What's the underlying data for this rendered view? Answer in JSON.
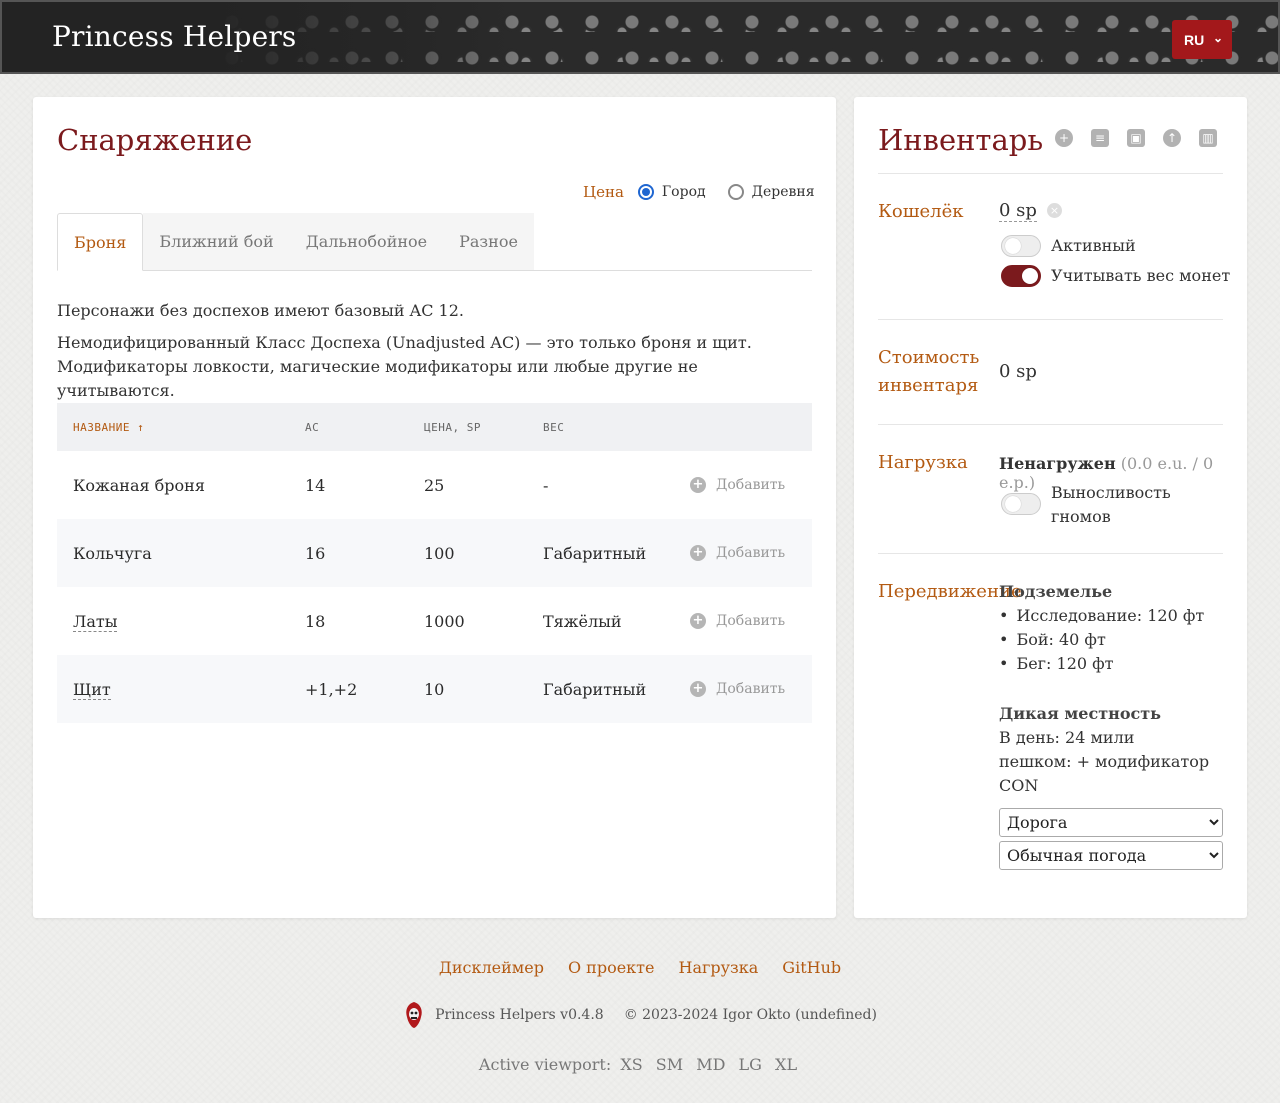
{
  "header": {
    "brand": "Princess Helpers",
    "lang": "RU"
  },
  "equipment": {
    "title": "Снаряжение",
    "price": {
      "label": "Цена",
      "options": [
        "Город",
        "Деревня"
      ],
      "selected": "Город"
    },
    "tabs": [
      "Броня",
      "Ближний бой",
      "Дальнобойное",
      "Разное"
    ],
    "active_tab": "Броня",
    "desc1": "Персонажи без доспехов имеют базовый AC 12.",
    "desc2": "Немодифицированный Класс Доспеха (Unadjusted AC) — это только броня и щит. Модификаторы ловкости, магические модификаторы или любые другие не учитываются.",
    "columns": {
      "name": "НАЗВАНИЕ ↑",
      "ac": "AC",
      "price": "ЦЕНА, SP",
      "weight": "ВЕС"
    },
    "add_label": "Добавить",
    "rows": [
      {
        "name": "Кожаная броня",
        "ac": "14",
        "price": "25",
        "weight": "-"
      },
      {
        "name": "Кольчуга",
        "ac": "16",
        "price": "100",
        "weight": "Габаритный"
      },
      {
        "name": "Латы",
        "ac": "18",
        "price": "1000",
        "weight": "Тяжёлый"
      },
      {
        "name": "Щит",
        "ac": "+1,+2",
        "price": "10",
        "weight": "Габаритный"
      }
    ]
  },
  "inventory": {
    "title": "Инвентарь",
    "tool_icons": [
      "plus-circle-icon",
      "coins-icon",
      "briefcase-icon",
      "upload-icon",
      "trash-icon"
    ],
    "purse": {
      "label": "Кошелёк",
      "value": "0 sp",
      "active_label": "Активный",
      "active_on": false,
      "coin_weight_label": "Учитывать вес монет",
      "coin_weight_on": true
    },
    "cost": {
      "label_line1": "Стоимость",
      "label_line2": "инвентаря",
      "value": "0 sp"
    },
    "load": {
      "label": "Нагрузка",
      "status": "Ненагружен",
      "detail": "(0.0 e.u. / 0 e.p.)",
      "dwarf_label_line1": "Выносливость",
      "dwarf_label_line2": "гномов",
      "dwarf_on": false
    },
    "movement": {
      "label": "Передвижение",
      "dungeon_title": "Подземелье",
      "dungeon": [
        "Исследование: 120 фт",
        "Бой: 40 фт",
        "Бег: 120 фт"
      ],
      "wild_title": "Дикая местность",
      "wild_line1": "В день: 24 мили",
      "wild_line2": "пешком: + модификатор",
      "wild_line3": "CON",
      "terrain": "Дорога",
      "weather": "Обычная погода"
    }
  },
  "footer": {
    "links": [
      "Дисклеймер",
      "О проекте",
      "Нагрузка",
      "GitHub"
    ],
    "version": "Princess Helpers v0.4.8",
    "copyright": "© 2023-2024 Igor Okto (undefined)",
    "viewport_label": "Active viewport:",
    "breakpoints": [
      "XS",
      "SM",
      "MD",
      "LG",
      "XL"
    ]
  },
  "colors": {
    "accent": "#7b1a1d",
    "link": "#b35a12",
    "lang_bg": "#a3181b"
  }
}
